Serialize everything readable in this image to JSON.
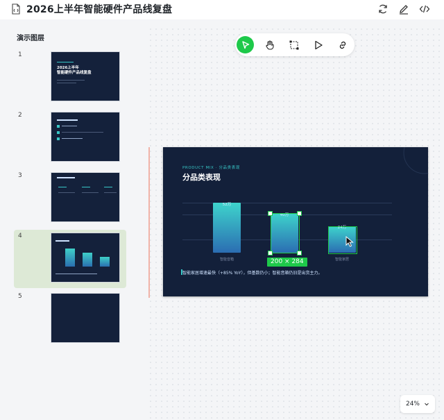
{
  "header": {
    "title": "2026上半年智能硬件产品线复盘"
  },
  "toolbar_top": {
    "icons": [
      "refresh-icon",
      "edit-icon",
      "code-icon"
    ]
  },
  "sidebar": {
    "title": "演示图层",
    "slides": [
      {
        "num": "1",
        "lines": [
          "2026上半年",
          "智能硬件产品线复盘"
        ]
      },
      {
        "num": "2"
      },
      {
        "num": "3"
      },
      {
        "num": "4"
      },
      {
        "num": "5"
      }
    ]
  },
  "tools": [
    "pointer-icon",
    "hand-icon",
    "frame-icon",
    "play-icon",
    "link-icon"
  ],
  "slide": {
    "kicker": "PRODUCT MIX · 分品类表现",
    "heading": "分品类表现",
    "bars": [
      {
        "value": "52万",
        "label": "智能音箱"
      },
      {
        "value": "40万",
        "label": ""
      },
      {
        "value": "24万",
        "label": "智能家居"
      }
    ],
    "footnote": "智能家居增速最快（+85% YoY），但基数仍小；智能音箱仍旧是出货主力。"
  },
  "selection": {
    "dims": "200 × 284"
  },
  "zoom": {
    "level": "24%"
  },
  "colors": {
    "accent": "#1ec94a",
    "slide_bg": "#13203a",
    "teal": "#38c7c7"
  }
}
